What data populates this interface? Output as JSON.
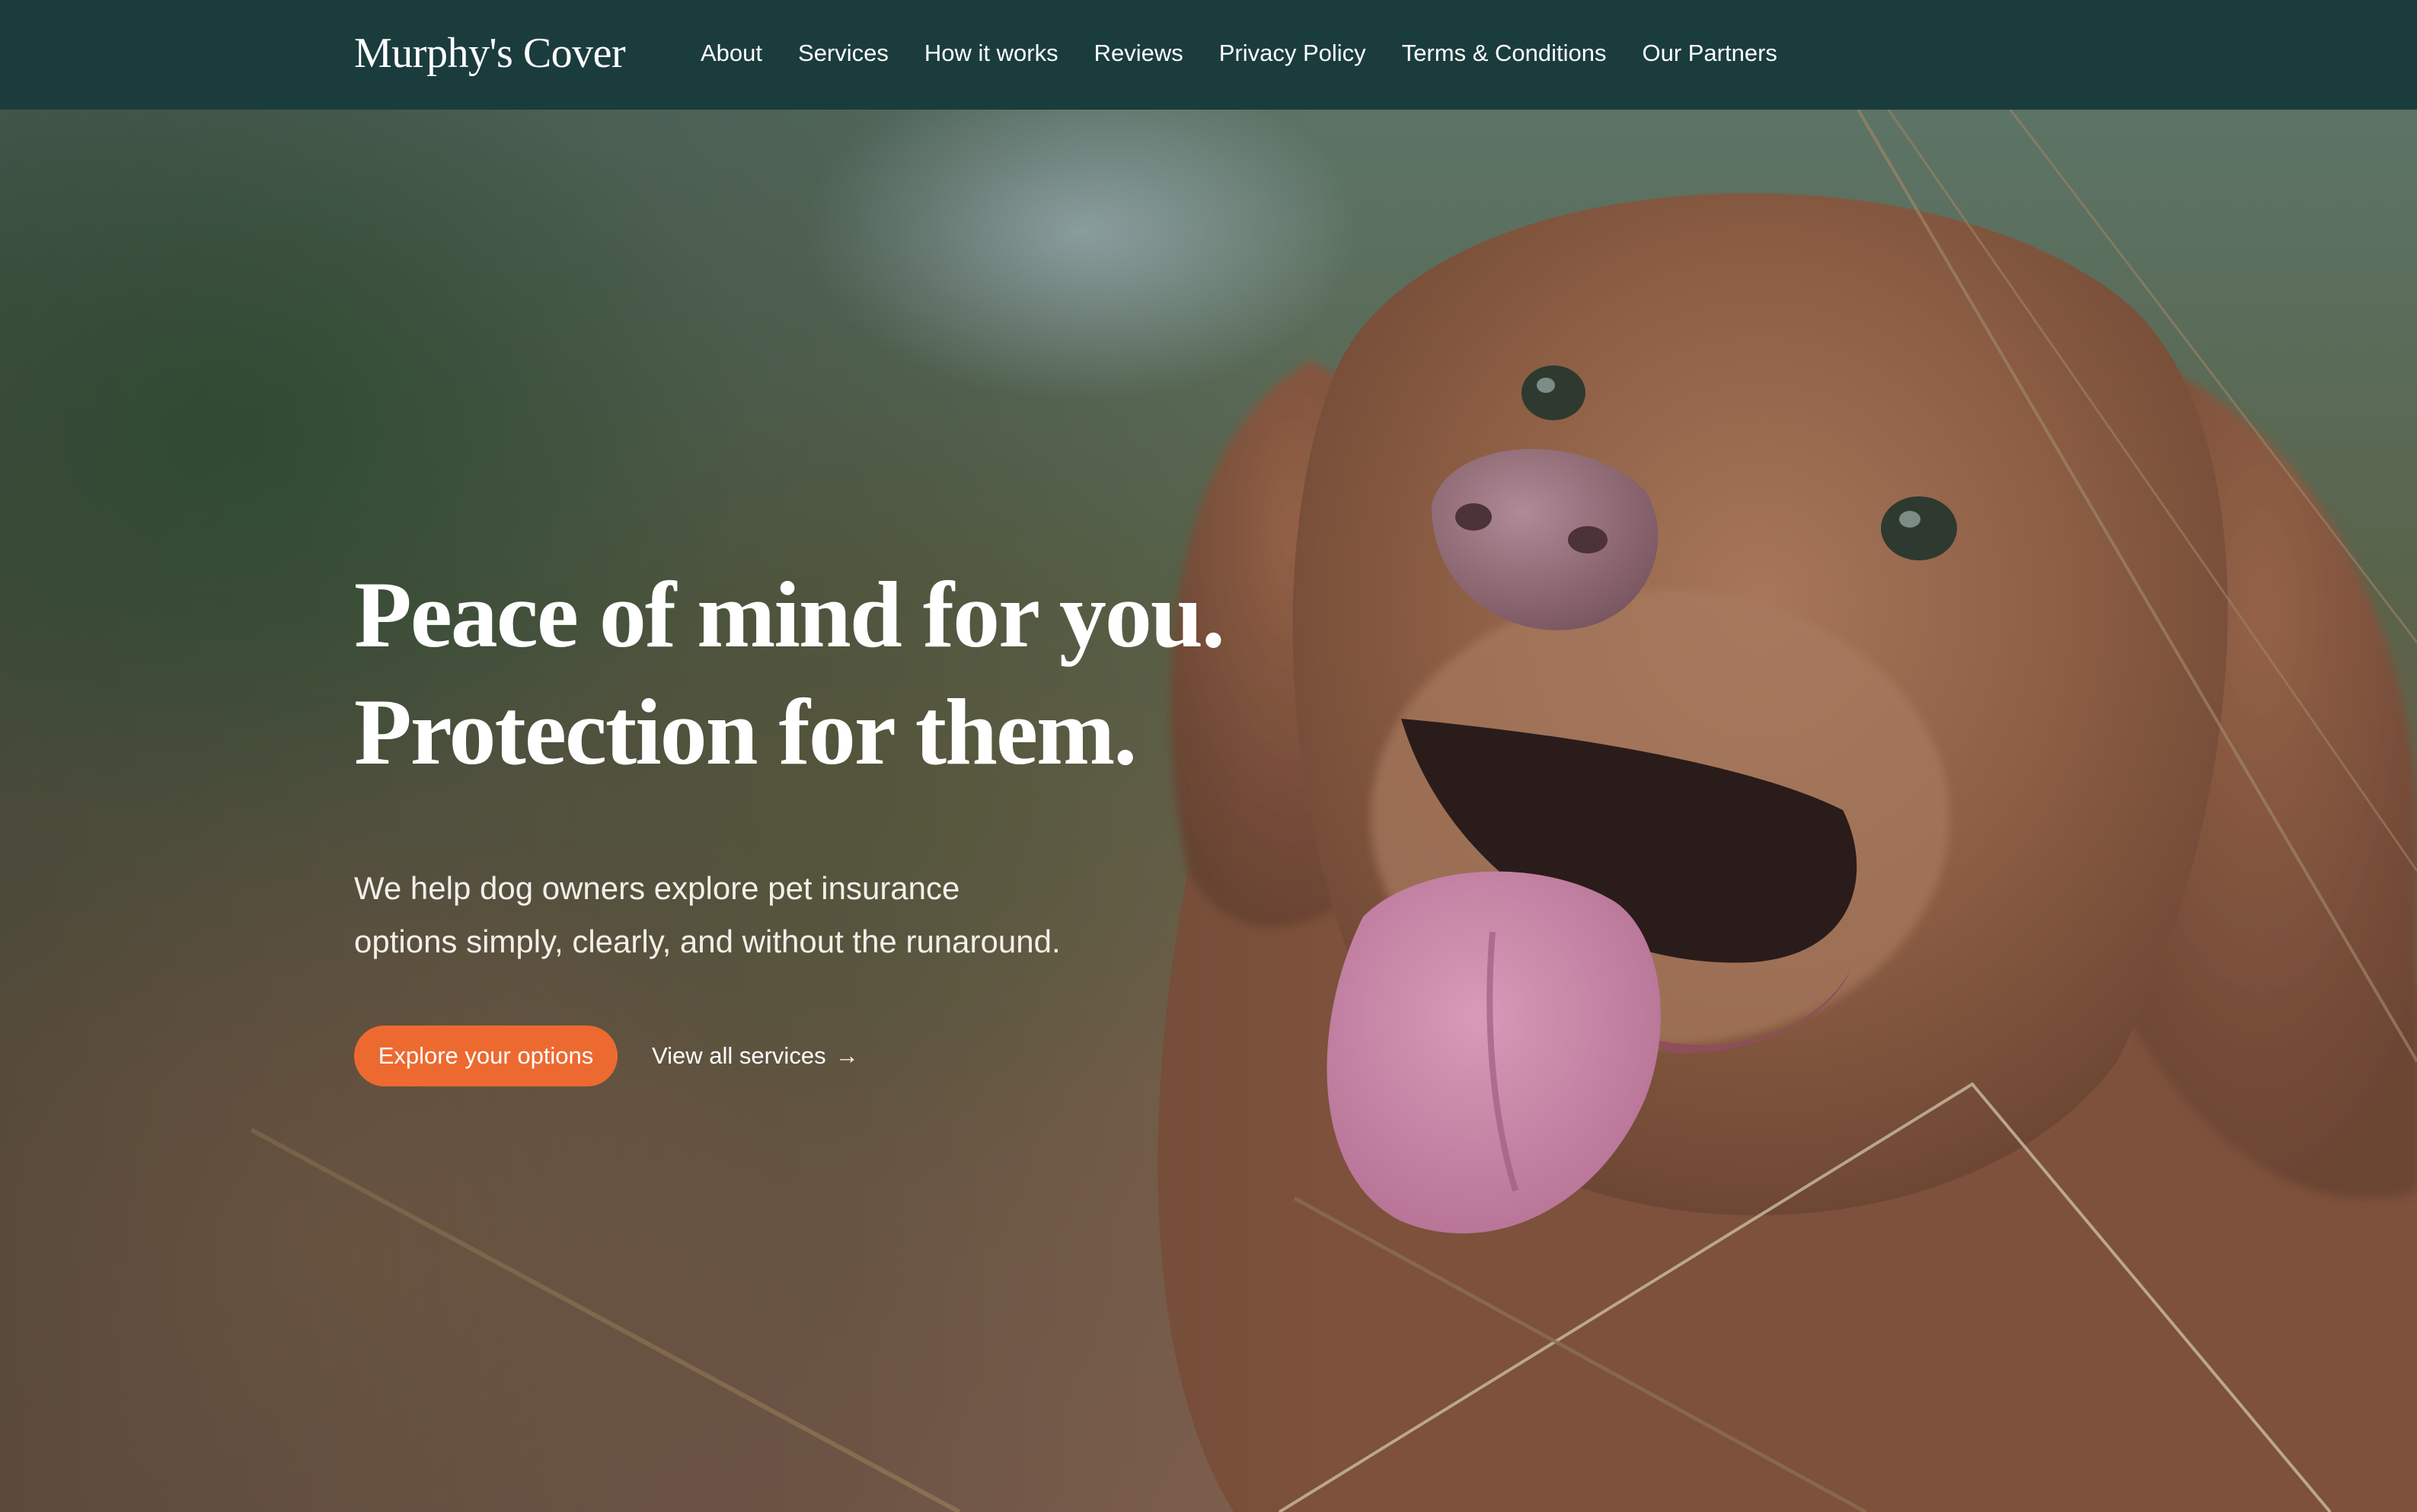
{
  "nav": {
    "brand": "Murphy's Cover",
    "links": [
      "About",
      "Services",
      "How it works",
      "Reviews",
      "Privacy Policy",
      "Terms & Conditions",
      "Our Partners"
    ]
  },
  "hero": {
    "headline_line1": "Peace of mind for you.",
    "headline_line2": "Protection for them.",
    "subtext_line1": "We help dog owners explore pet insurance",
    "subtext_line2": "options simply, clearly, and without the runaround.",
    "cta_primary": "Explore your options",
    "cta_secondary": "View all services",
    "cta_secondary_icon": "arrow-right-icon",
    "background_image": "dog-photo"
  },
  "colors": {
    "nav_bg": "#1b3c3d",
    "accent": "#ec6a30",
    "text": "#ffffff"
  }
}
